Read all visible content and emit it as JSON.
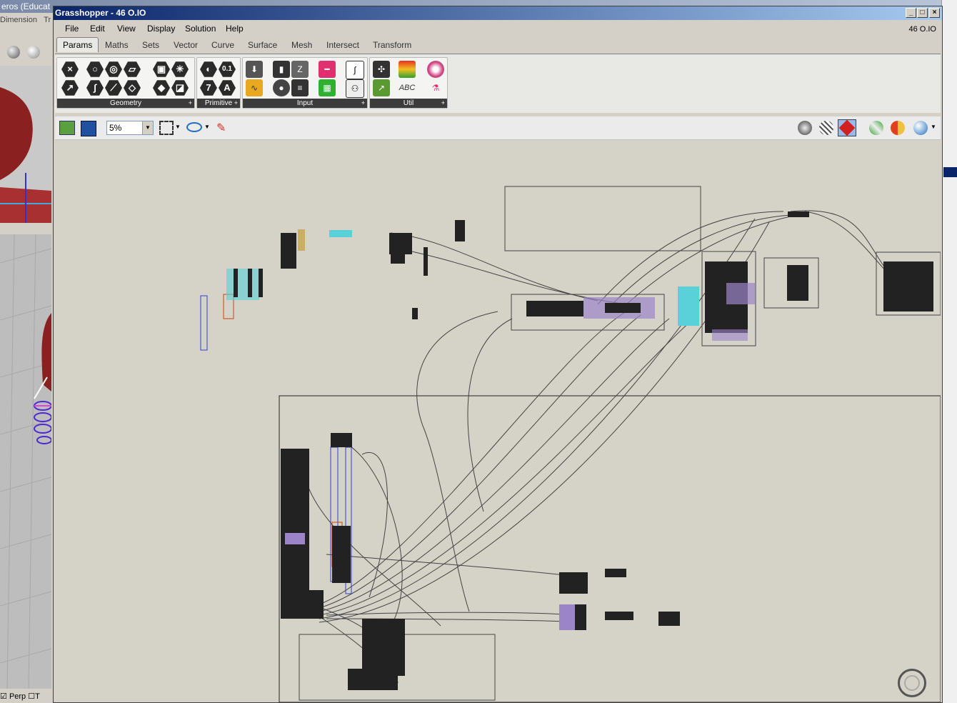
{
  "rhino": {
    "title": "eros (Educat",
    "menu_items": [
      "Dimension",
      "Tr"
    ],
    "status_perp": "Perp",
    "status_t": "T"
  },
  "window": {
    "title": "Grasshopper - 46 O.IO",
    "version": "46 O.IO",
    "minimize_label": "_",
    "maximize_label": "□",
    "close_label": "×"
  },
  "menu": {
    "items": [
      "File",
      "Edit",
      "View",
      "Display",
      "Solution",
      "Help"
    ]
  },
  "tabs": [
    "Params",
    "Maths",
    "Sets",
    "Vector",
    "Curve",
    "Surface",
    "Mesh",
    "Intersect",
    "Transform"
  ],
  "active_tab": "Params",
  "ribbon": {
    "panels": [
      {
        "label": "Geometry"
      },
      {
        "label": "Primitive"
      },
      {
        "label": "Input"
      },
      {
        "label": "Util"
      }
    ],
    "expand_glyph": "+"
  },
  "canvas_toolbar": {
    "zoom": "5%"
  },
  "colors": {
    "title_bar": "#0a246a",
    "canvas": "#d5d2c8",
    "wire": "#333333",
    "highlight_cyan": "#5ad0d8",
    "highlight_purple": "#9b84c8"
  }
}
